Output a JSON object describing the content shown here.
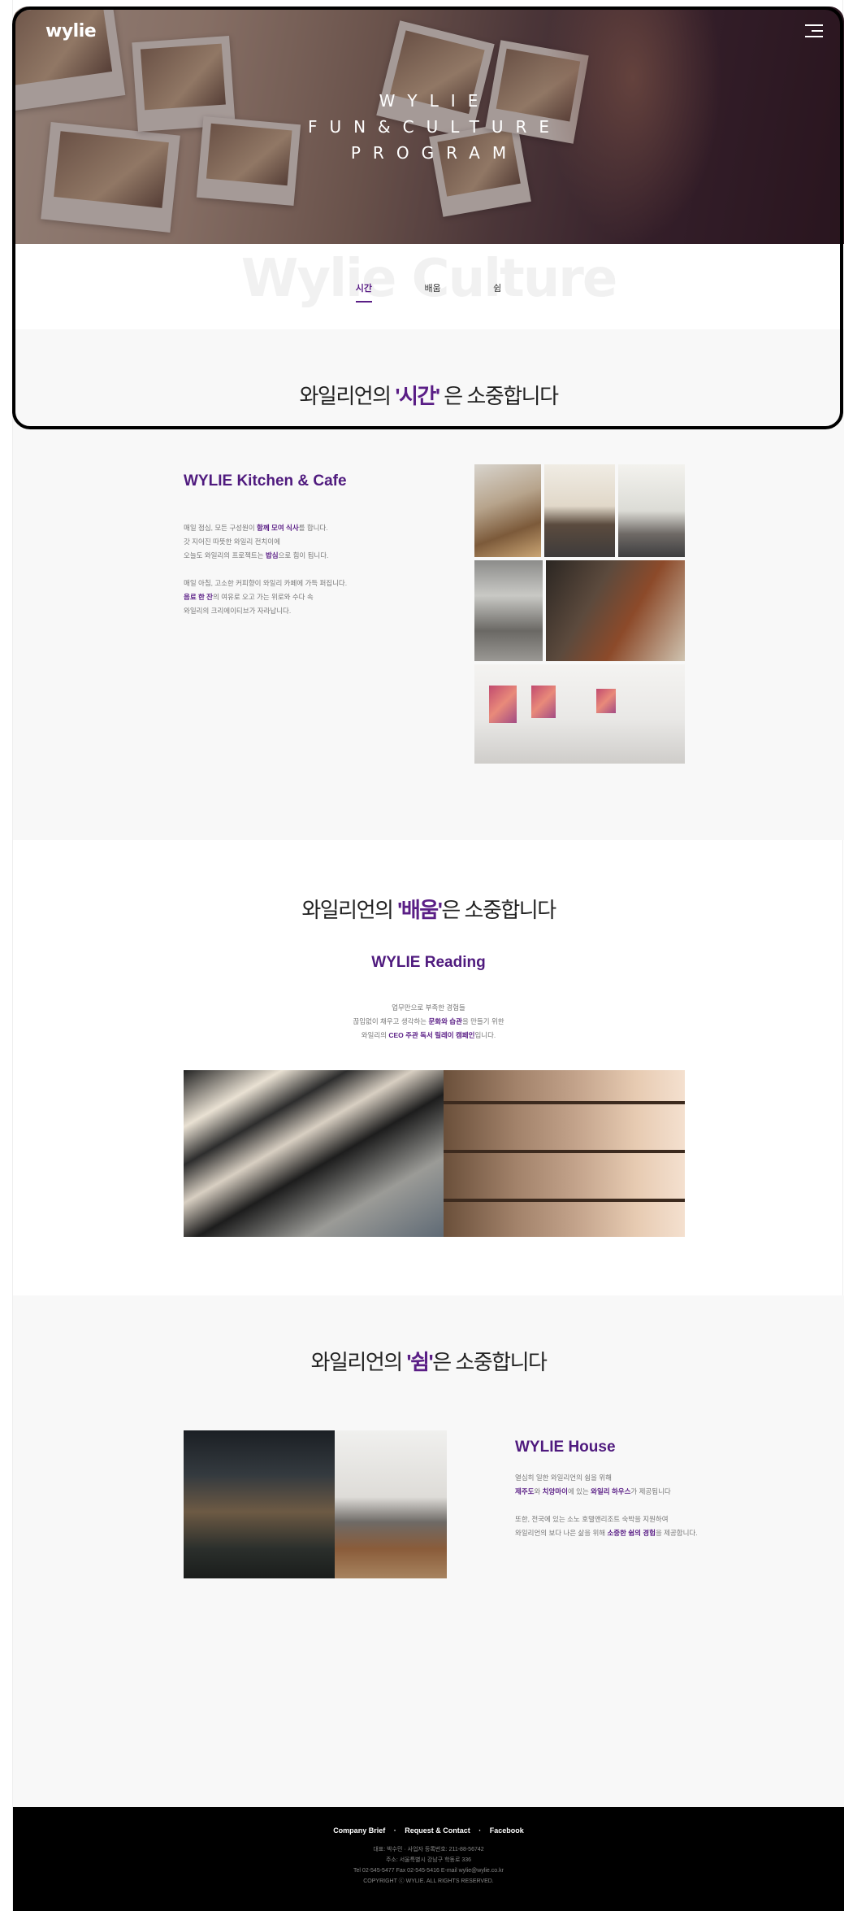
{
  "header": {
    "logo": "wylie",
    "menu_icon": "hamburger-menu-icon",
    "hero_lines": [
      "WYLIE",
      "FUN&CULTURE",
      "PROGRAM"
    ]
  },
  "tabbar": {
    "background_text": "Wylie Culture",
    "tabs": [
      {
        "label": "시간",
        "active": true
      },
      {
        "label": "배움",
        "active": false
      },
      {
        "label": "쉼",
        "active": false
      }
    ]
  },
  "sections": {
    "time": {
      "title_pre": "와일리언의 ",
      "title_em": "'시간'",
      "title_post": " 은 소중합니다",
      "feature_title": "WYLIE Kitchen & Cafe",
      "p1": [
        {
          "pre": "매일 점심, 모든 구성원이 ",
          "em": "함께 모여 식사",
          "post": "를 합니다."
        },
        {
          "pre": "갓 지어진 따뜻한 와일리 전치이에",
          "em": "",
          "post": ""
        },
        {
          "pre": "오늘도 와일리의 프로젝트는 ",
          "em": "밥심",
          "post": "으로 힘이 됩니다."
        }
      ],
      "p2": [
        {
          "pre": "매일 아침, 고소한 커피향이 와일리 카페에 가득 퍼집니다.",
          "em": "",
          "post": ""
        },
        {
          "pre": "",
          "em": "음료 한 잔",
          "post": "의 여유로 오고 가는 위로와 수다 속"
        },
        {
          "pre": "와일리의 크리에이티브가 자라납니다.",
          "em": "",
          "post": ""
        }
      ]
    },
    "learn": {
      "title_pre": "와일리언의 ",
      "title_em": "'배움'",
      "title_post": "은 소중합니다",
      "feature_title": "WYLIE Reading",
      "p1": [
        {
          "pre": "업무만으로 부족한 경험들",
          "em": "",
          "post": ""
        },
        {
          "pre": "끊임없이 채우고 생각하는 ",
          "em": "문화와 습관",
          "post": "을 만들기 위한"
        },
        {
          "pre": "와일리의 ",
          "em": "CEO 주관 독서 릴레이 캠페인",
          "post": "입니다."
        }
      ]
    },
    "rest": {
      "title_pre": "와일리언의 ",
      "title_em": "'쉼'",
      "title_post": "은 소중합니다",
      "feature_title": "WYLIE House",
      "p1": [
        {
          "pre": "열심히 일한 와일리언의 쉼을 위해",
          "em": "",
          "post": ""
        },
        {
          "pre": "",
          "em": "제주도",
          "post": "와 "
        },
        {
          "pre": "",
          "em": "치앙마이",
          "post": "에 있는 "
        },
        {
          "pre": "",
          "em": "와일리 하우스",
          "post": "가 제공됩니다"
        }
      ],
      "p2": [
        {
          "pre": "또한, 전국에 있는 소노 호텔앤리조트 숙박을 지원하여",
          "em": "",
          "post": ""
        },
        {
          "pre": "와일리언의 보다 나은 삶을 위해 ",
          "em": "소중한 쉼의 경험",
          "post": "을 제공합니다."
        }
      ]
    }
  },
  "footer": {
    "links": [
      "Company Brief",
      "Request & Contact",
      "Facebook"
    ],
    "info": [
      "대표: 박수민 · 사업자 등록번호: 211-88-56742",
      "주소: 서울특별시 강남구 학동로 336",
      "Tel 02-545-5477  Fax 02-545-5416  E-mail wylie@wylie.co.kr",
      "COPYRIGHT ⓒ WYLIE. ALL RIGHTS RESERVED."
    ]
  },
  "colors": {
    "accent": "#5a1e86",
    "footer_bg": "#000000",
    "grey_bg": "#f8f8f8"
  }
}
